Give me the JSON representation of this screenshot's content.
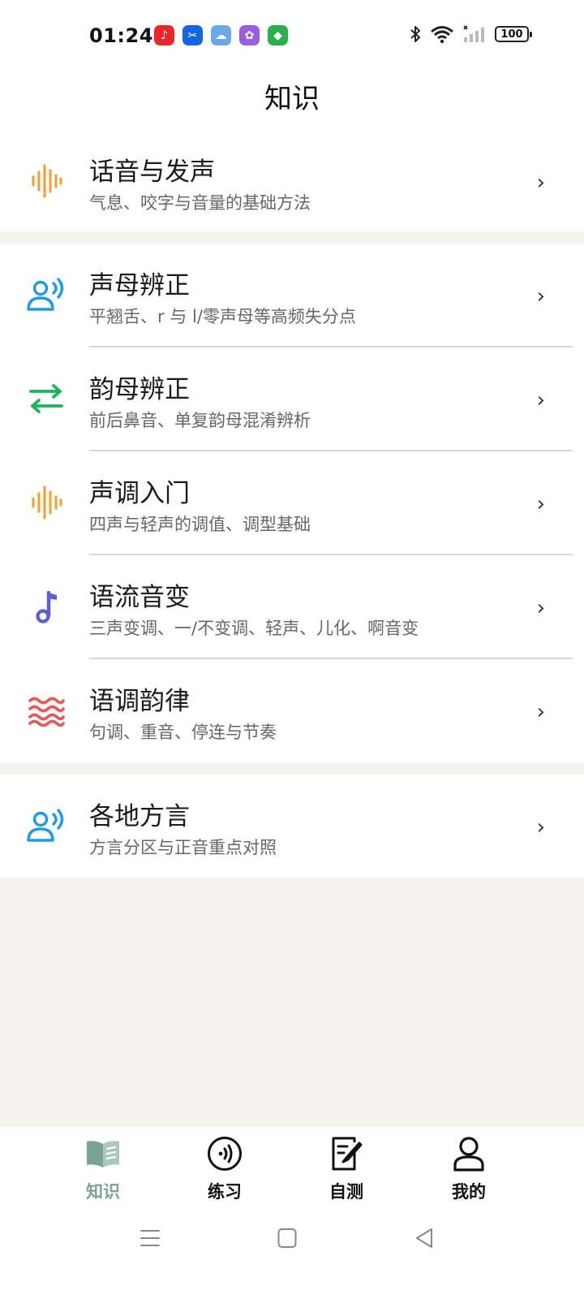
{
  "status": {
    "time": "01:24",
    "battery": "100",
    "apps": [
      {
        "name": "music-app-icon",
        "color": "#e8262c",
        "glyph": "♪"
      },
      {
        "name": "capcut-app-icon",
        "color": "#1466e0",
        "glyph": "✂"
      },
      {
        "name": "weather-app-icon",
        "color": "#6aa8e8",
        "glyph": "☁"
      },
      {
        "name": "gallery-app-icon",
        "color": "#9a5de0",
        "glyph": "✿"
      },
      {
        "name": "security-app-icon",
        "color": "#28b04a",
        "glyph": "◆"
      }
    ]
  },
  "header": {
    "title": "知识"
  },
  "groups": [
    {
      "items": [
        {
          "title": "话音与发声",
          "subtitle": "气息、咬字与音量的基础方法",
          "icon": "waveform-icon",
          "color": "#f0a33c"
        }
      ]
    },
    {
      "items": [
        {
          "title": "声母辨正",
          "subtitle": "平翘舌、r 与 l/零声母等高频失分点",
          "icon": "speaking-person-icon",
          "color": "#1e9be8"
        },
        {
          "title": "韵母辨正",
          "subtitle": "前后鼻音、单复韵母混淆辨析",
          "icon": "swap-arrows-icon",
          "color": "#1db35c"
        },
        {
          "title": "声调入门",
          "subtitle": "四声与轻声的调值、调型基础",
          "icon": "waveform-icon",
          "color": "#f0a33c"
        },
        {
          "title": "语流音变",
          "subtitle": "三声变调、一/不变调、轻声、儿化、啊音变",
          "icon": "music-note-icon",
          "color": "#5b5fd6"
        },
        {
          "title": "语调韵律",
          "subtitle": "句调、重音、停连与节奏",
          "icon": "waves-icon",
          "color": "#e85858"
        }
      ]
    },
    {
      "items": [
        {
          "title": "各地方言",
          "subtitle": "方言分区与正音重点对照",
          "icon": "speaking-person-icon",
          "color": "#1e9be8"
        }
      ]
    }
  ],
  "nav": {
    "items": [
      {
        "label": "知识",
        "icon": "book-icon",
        "active": true
      },
      {
        "label": "练习",
        "icon": "audio-circle-icon",
        "active": false
      },
      {
        "label": "自测",
        "icon": "edit-document-icon",
        "active": false
      },
      {
        "label": "我的",
        "icon": "user-icon",
        "active": false
      }
    ]
  },
  "colors": {
    "active": "#7aa394",
    "background": "#f6f3ee"
  }
}
